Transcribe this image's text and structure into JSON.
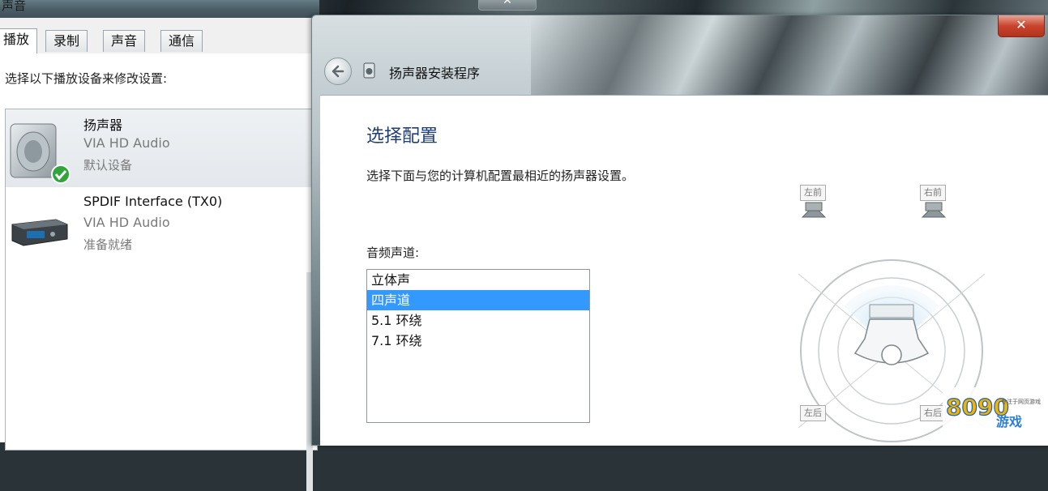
{
  "sound_window": {
    "title": "声音",
    "tabs": [
      "播放",
      "录制",
      "声音",
      "通信"
    ],
    "instruction": "选择以下播放设备来修改设置:",
    "devices": [
      {
        "name": "扬声器",
        "driver": "VIA HD Audio",
        "status": "默认设备"
      },
      {
        "name": "SPDIF Interface (TX0)",
        "driver": "VIA HD Audio",
        "status": "准备就绪"
      }
    ],
    "close_glyph": "✕"
  },
  "setup_window": {
    "title": "扬声器安装程序",
    "close_glyph": "✕",
    "heading": "选择配置",
    "description": "选择下面与您的计算机配置最相近的扬声器设置。",
    "channels_label": "音频声道:",
    "channels": [
      "立体声",
      "四声道",
      "5.1 环绕",
      "7.1 环绕"
    ],
    "selected_channel": "四声道",
    "speaker_labels": {
      "front_left": "左前",
      "front_right": "右前",
      "rear_left": "左后",
      "rear_right": "右后"
    }
  },
  "colors": {
    "selection": "#3399ff",
    "heading": "#1f3d7a",
    "close_button": "#c9442c"
  }
}
